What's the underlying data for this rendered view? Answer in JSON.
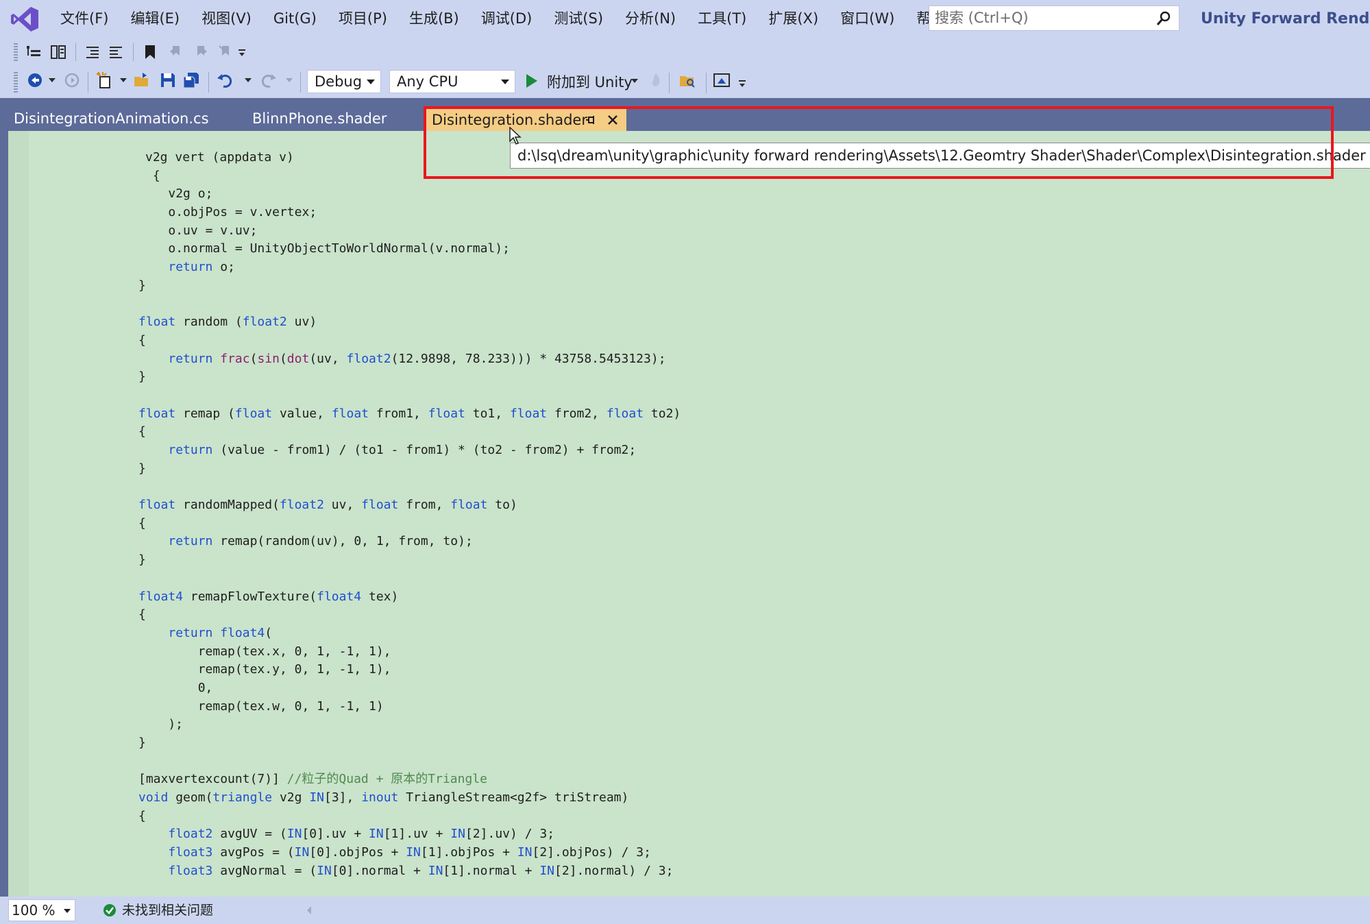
{
  "menu": {
    "items": [
      "文件(F)",
      "编辑(E)",
      "视图(V)",
      "Git(G)",
      "项目(P)",
      "生成(B)",
      "调试(D)",
      "测试(S)",
      "分析(N)",
      "工具(T)",
      "扩展(X)",
      "窗口(W)",
      "帮助(H)"
    ],
    "search_placeholder": "搜索 (Ctrl+Q)",
    "solution_title": "Unity Forward Renderin"
  },
  "toolbar": {
    "config": "Debug",
    "platform": "Any CPU",
    "attach": "附加到 Unity"
  },
  "tabs": {
    "tab1": "DisintegrationAnimation.cs",
    "tab2": "BlinnPhone.shader",
    "active": "Disintegration.shader",
    "tooltip": "d:\\lsq\\dream\\unity\\graphic\\unity forward rendering\\Assets\\12.Geomtry Shader\\Shader\\Complex\\Disintegration.shader"
  },
  "code": [
    "v2g vert (appdata v)",
    " {",
    "    v2g o;",
    "    o.objPos = v.vertex;",
    "    o.uv = v.uv;",
    "    o.normal = UnityObjectToWorldNormal(v.normal);",
    "    return o;",
    "}",
    "",
    "float random (float2 uv)",
    "{",
    "    return frac(sin(dot(uv, float2(12.9898, 78.233))) * 43758.5453123);",
    "}",
    "",
    "float remap (float value, float from1, float to1, float from2, float to2)",
    "{",
    "    return (value - from1) / (to1 - from1) * (to2 - from2) + from2;",
    "}",
    "",
    "float randomMapped(float2 uv, float from, float to)",
    "{",
    "    return remap(random(uv), 0, 1, from, to);",
    "}",
    "",
    "float4 remapFlowTexture(float4 tex)",
    "{",
    "    return float4(",
    "        remap(tex.x, 0, 1, -1, 1),",
    "        remap(tex.y, 0, 1, -1, 1),",
    "        0,",
    "        remap(tex.w, 0, 1, -1, 1)",
    "    );",
    "}",
    "",
    "[maxvertexcount(7)] //粒子的Quad + 原本的Triangle",
    "void geom(triangle v2g IN[3], inout TriangleStream<g2f> triStream)",
    "{",
    "    float2 avgUV = (IN[0].uv + IN[1].uv + IN[2].uv) / 3;",
    "    float3 avgPos = (IN[0].objPos + IN[1].objPos + IN[2].objPos) / 3;",
    "    float3 avgNormal = (IN[0].normal + IN[1].normal + IN[2].normal) / 3;"
  ],
  "status": {
    "zoom": "100 %",
    "message": "未找到相关问题"
  },
  "colors": {
    "editor_bg": "#cae3cb",
    "active_tab": "#f5cc84",
    "highlight": "#e8171e",
    "chrome": "#ccd5f0"
  }
}
